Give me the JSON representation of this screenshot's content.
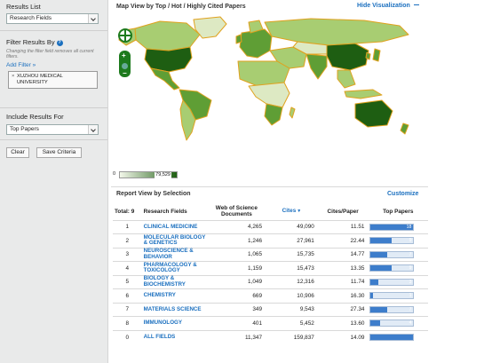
{
  "sidebar": {
    "results_list_title": "Results List",
    "results_list_value": "Research Fields",
    "filter_title": "Filter Results By",
    "filter_hint": "Changing the filter field removes all current filters.",
    "add_filter_label": "Add Filter »",
    "active_filter_remove": "×",
    "active_filter": "XUZHOU MEDICAL UNIVERSITY",
    "include_title": "Include Results For",
    "include_value": "Top Papers",
    "clear_label": "Clear",
    "save_label": "Save Criteria"
  },
  "map": {
    "title": "Map View by Top / Hot / Highly Cited Papers",
    "hide_label": "Hide Visualization",
    "legend_min": "0",
    "legend_max": "79,529",
    "colors": {
      "dark": "#1e5e12",
      "mid": "#5f9e35",
      "light": "#a8cd72",
      "pale": "#dde9c3",
      "border": "#e0a21e",
      "ocean": "#ffffff"
    }
  },
  "report": {
    "title": "Report View by Selection",
    "customize_label": "Customize",
    "headers": {
      "total": "Total: 9",
      "field": "Research Fields",
      "wos": "Web of Science Documents",
      "cites": "Cites",
      "cites_per_paper": "Cites/Paper",
      "top_papers": "Top Papers"
    },
    "rows": [
      {
        "rank": "1",
        "field": "CLINICAL MEDICINE",
        "wos": "4,265",
        "cites": "49,090",
        "cpp": "11.51",
        "top": "18",
        "level": 1.0
      },
      {
        "rank": "2",
        "field": "MOLECULAR BIOLOGY & GENETICS",
        "wos": "1,246",
        "cites": "27,961",
        "cpp": "22.44",
        "top": "9",
        "level": 0.5
      },
      {
        "rank": "3",
        "field": "NEUROSCIENCE & BEHAVIOR",
        "wos": "1,065",
        "cites": "15,735",
        "cpp": "14.77",
        "top": "7",
        "level": 0.39
      },
      {
        "rank": "4",
        "field": "PHARMACOLOGY & TOXICOLOGY",
        "wos": "1,159",
        "cites": "15,473",
        "cpp": "13.35",
        "top": "9",
        "level": 0.5
      },
      {
        "rank": "5",
        "field": "BIOLOGY & BIOCHEMISTRY",
        "wos": "1,049",
        "cites": "12,316",
        "cpp": "11.74",
        "top": "3",
        "level": 0.17
      },
      {
        "rank": "6",
        "field": "CHEMISTRY",
        "wos": "669",
        "cites": "10,906",
        "cpp": "16.30",
        "top": "1",
        "level": 0.06
      },
      {
        "rank": "7",
        "field": "MATERIALS SCIENCE",
        "wos": "349",
        "cites": "9,543",
        "cpp": "27.34",
        "top": "7",
        "level": 0.39
      },
      {
        "rank": "8",
        "field": "IMMUNOLOGY",
        "wos": "401",
        "cites": "5,452",
        "cpp": "13.60",
        "top": "4",
        "level": 0.22
      },
      {
        "rank": "0",
        "field": "ALL FIELDS",
        "wos": "11,347",
        "cites": "159,837",
        "cpp": "14.09",
        "top": "",
        "level": 1.0
      }
    ]
  }
}
